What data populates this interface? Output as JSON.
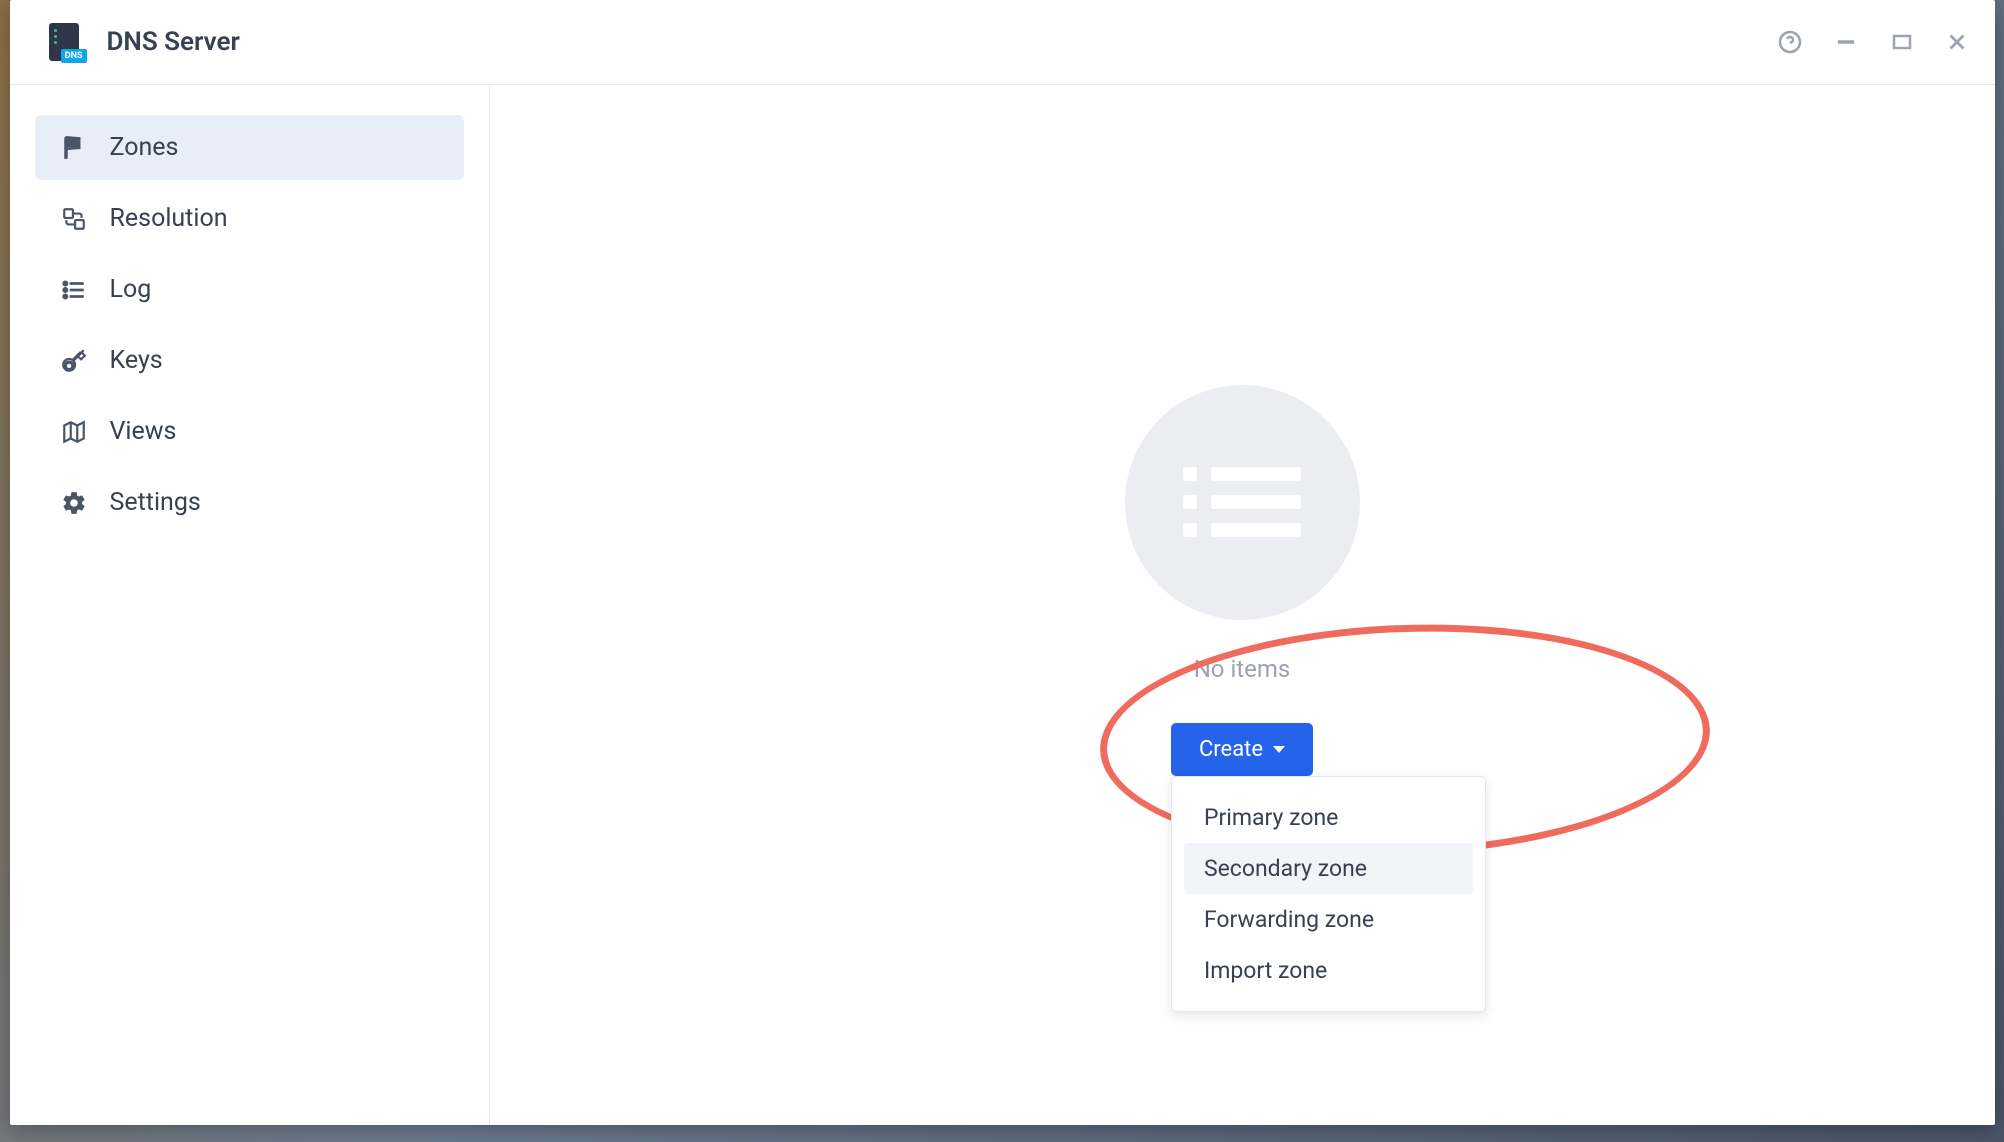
{
  "app": {
    "title": "DNS Server",
    "icon_badge": "DNS"
  },
  "sidebar": {
    "items": [
      {
        "id": "zones",
        "label": "Zones",
        "icon": "flag",
        "active": true
      },
      {
        "id": "resolution",
        "label": "Resolution",
        "icon": "resolution",
        "active": false
      },
      {
        "id": "log",
        "label": "Log",
        "icon": "list",
        "active": false
      },
      {
        "id": "keys",
        "label": "Keys",
        "icon": "key",
        "active": false
      },
      {
        "id": "views",
        "label": "Views",
        "icon": "map",
        "active": false
      },
      {
        "id": "settings",
        "label": "Settings",
        "icon": "gear",
        "active": false
      }
    ]
  },
  "main": {
    "empty_text": "No items",
    "create_button": "Create",
    "dropdown_items": [
      {
        "label": "Primary zone",
        "hover": false
      },
      {
        "label": "Secondary zone",
        "hover": true
      },
      {
        "label": "Forwarding zone",
        "hover": false
      },
      {
        "label": "Import zone",
        "hover": false
      }
    ]
  }
}
